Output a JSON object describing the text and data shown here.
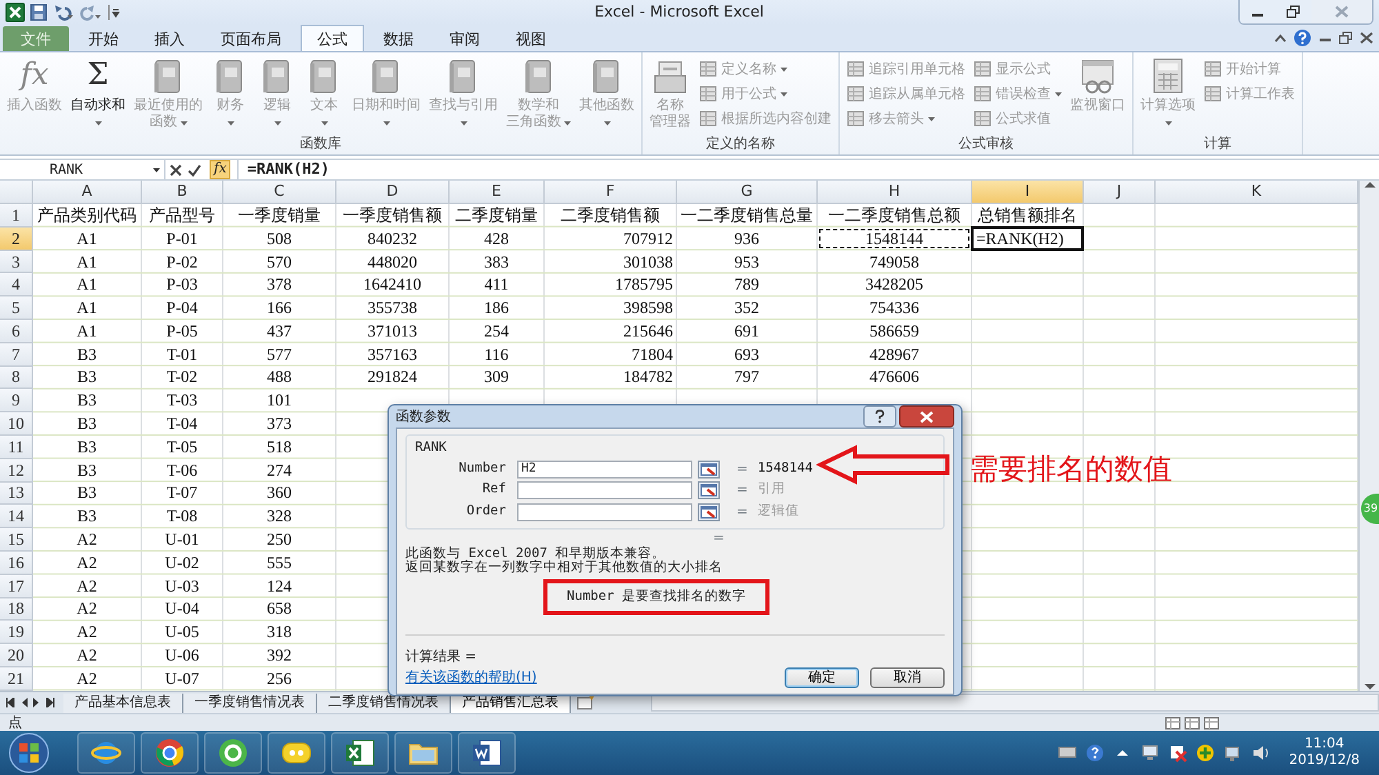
{
  "title_bar": {
    "title": "Excel - Microsoft Excel"
  },
  "ribbon_tabs": [
    {
      "label": "文件",
      "kind": "file",
      "selected": false
    },
    {
      "label": "开始",
      "kind": "tab",
      "selected": false
    },
    {
      "label": "插入",
      "kind": "tab",
      "selected": false
    },
    {
      "label": "页面布局",
      "kind": "tab",
      "selected": false
    },
    {
      "label": "公式",
      "kind": "tab",
      "selected": true
    },
    {
      "label": "数据",
      "kind": "tab",
      "selected": false
    },
    {
      "label": "审阅",
      "kind": "tab",
      "selected": false
    },
    {
      "label": "视图",
      "kind": "tab",
      "selected": false
    }
  ],
  "ribbon_groups": [
    {
      "label": "函数库",
      "buttons": [
        {
          "kind": "large",
          "glyph": "fx",
          "label": [
            "插入函数"
          ],
          "disabled": true,
          "dropdown": false
        },
        {
          "kind": "large",
          "glyph": "Σ",
          "label": [
            "自动求和"
          ],
          "disabled": false,
          "dropdown": true
        },
        {
          "kind": "large",
          "label": [
            "最近使用的",
            "函数"
          ],
          "disabled": true,
          "dropdown": true
        },
        {
          "kind": "large",
          "label": [
            "财务"
          ],
          "disabled": true,
          "dropdown": true
        },
        {
          "kind": "large",
          "label": [
            "逻辑"
          ],
          "disabled": true,
          "dropdown": true
        },
        {
          "kind": "large",
          "label": [
            "文本"
          ],
          "disabled": true,
          "dropdown": true
        },
        {
          "kind": "large",
          "label": [
            "日期和时间"
          ],
          "disabled": true,
          "dropdown": true
        },
        {
          "kind": "large",
          "label": [
            "查找与引用"
          ],
          "disabled": true,
          "dropdown": true
        },
        {
          "kind": "large",
          "label": [
            "数学和",
            "三角函数"
          ],
          "disabled": true,
          "dropdown": true
        },
        {
          "kind": "large",
          "label": [
            "其他函数"
          ],
          "disabled": true,
          "dropdown": true
        }
      ]
    },
    {
      "label": "定义的名称",
      "buttons": [
        {
          "kind": "large",
          "label": [
            "名称",
            "管理器"
          ],
          "disabled": true,
          "dropdown": false
        },
        {
          "kind": "small",
          "label": "定义名称",
          "disabled": true,
          "dropdown": true
        },
        {
          "kind": "small",
          "label": "用于公式",
          "disabled": true,
          "dropdown": true
        },
        {
          "kind": "small",
          "label": "根据所选内容创建",
          "disabled": true,
          "dropdown": false
        }
      ]
    },
    {
      "label": "公式审核",
      "buttons": [
        {
          "kind": "small",
          "label": "追踪引用单元格",
          "disabled": true,
          "dropdown": false
        },
        {
          "kind": "small",
          "label": "追踪从属单元格",
          "disabled": true,
          "dropdown": false
        },
        {
          "kind": "small",
          "label": "移去箭头",
          "disabled": true,
          "dropdown": true
        },
        {
          "kind": "small",
          "label": "显示公式",
          "disabled": true,
          "dropdown": false
        },
        {
          "kind": "small",
          "label": "错误检查",
          "disabled": true,
          "dropdown": true
        },
        {
          "kind": "small",
          "label": "公式求值",
          "disabled": true,
          "dropdown": false
        },
        {
          "kind": "large",
          "label": [
            "监视窗口"
          ],
          "disabled": true,
          "dropdown": false
        }
      ]
    },
    {
      "label": "计算",
      "buttons": [
        {
          "kind": "large",
          "label": [
            "计算选项"
          ],
          "disabled": true,
          "dropdown": true
        },
        {
          "kind": "small",
          "label": "开始计算",
          "disabled": true,
          "dropdown": false
        },
        {
          "kind": "small",
          "label": "计算工作表",
          "disabled": true,
          "dropdown": false
        }
      ]
    }
  ],
  "formula_bar": {
    "name_box": "RANK",
    "fx": "fx",
    "formula": "=RANK(H2)"
  },
  "columns": [
    {
      "label": "A",
      "selected": false
    },
    {
      "label": "B",
      "selected": false
    },
    {
      "label": "C",
      "selected": false
    },
    {
      "label": "D",
      "selected": false
    },
    {
      "label": "E",
      "selected": false
    },
    {
      "label": "F",
      "selected": false
    },
    {
      "label": "G",
      "selected": false
    },
    {
      "label": "H",
      "selected": false
    },
    {
      "label": "I",
      "selected": true
    },
    {
      "label": "J",
      "selected": false
    },
    {
      "label": "K",
      "selected": false
    }
  ],
  "rows": [
    {
      "header": "1",
      "selected": false,
      "cells": [
        "产品类别代码",
        "产品型号",
        "一季度销量",
        "一季度销售额",
        "二季度销量",
        "二季度销售额",
        "一二季度销售总量",
        "一二季度销售总额",
        "总销售额排名"
      ]
    },
    {
      "header": "2",
      "selected": true,
      "cells": [
        "A1",
        "P-01",
        "508",
        "840232",
        "428",
        "707912",
        "936",
        {
          "text": "1548144",
          "marquee": true
        },
        {
          "text": "=RANK(H2)",
          "editing": true
        }
      ]
    },
    {
      "header": "3",
      "selected": false,
      "cells": [
        "A1",
        "P-02",
        "570",
        "448020",
        "383",
        "301038",
        "953",
        "749058"
      ]
    },
    {
      "header": "4",
      "selected": false,
      "cells": [
        "A1",
        "P-03",
        "378",
        "1642410",
        "411",
        "1785795",
        "789",
        "3428205"
      ]
    },
    {
      "header": "5",
      "selected": false,
      "cells": [
        "A1",
        "P-04",
        "166",
        "355738",
        "186",
        "398598",
        "352",
        "754336"
      ]
    },
    {
      "header": "6",
      "selected": false,
      "cells": [
        "A1",
        "P-05",
        "437",
        "371013",
        "254",
        "215646",
        "691",
        "586659"
      ]
    },
    {
      "header": "7",
      "selected": false,
      "cells": [
        "B3",
        "T-01",
        "577",
        "357163",
        "116",
        "71804",
        "693",
        "428967"
      ]
    },
    {
      "header": "8",
      "selected": false,
      "cells": [
        "B3",
        "T-02",
        "488",
        "291824",
        "309",
        "184782",
        "797",
        "476606"
      ]
    },
    {
      "header": "9",
      "selected": false,
      "cells": [
        "B3",
        "T-03",
        "101"
      ]
    },
    {
      "header": "10",
      "selected": false,
      "cells": [
        "B3",
        "T-04",
        "373"
      ]
    },
    {
      "header": "11",
      "selected": false,
      "cells": [
        "B3",
        "T-05",
        "518"
      ]
    },
    {
      "header": "12",
      "selected": false,
      "cells": [
        "B3",
        "T-06",
        "274"
      ]
    },
    {
      "header": "13",
      "selected": false,
      "cells": [
        "B3",
        "T-07",
        "360"
      ]
    },
    {
      "header": "14",
      "selected": false,
      "cells": [
        "B3",
        "T-08",
        "328"
      ]
    },
    {
      "header": "15",
      "selected": false,
      "cells": [
        "A2",
        "U-01",
        "250"
      ]
    },
    {
      "header": "16",
      "selected": false,
      "cells": [
        "A2",
        "U-02",
        "555"
      ]
    },
    {
      "header": "17",
      "selected": false,
      "cells": [
        "A2",
        "U-03",
        "124"
      ]
    },
    {
      "header": "18",
      "selected": false,
      "cells": [
        "A2",
        "U-04",
        "658"
      ]
    },
    {
      "header": "19",
      "selected": false,
      "cells": [
        "A2",
        "U-05",
        "318"
      ]
    },
    {
      "header": "20",
      "selected": false,
      "cells": [
        "A2",
        "U-06",
        "392"
      ]
    },
    {
      "header": "21",
      "selected": false,
      "cells": [
        "A2",
        "U-07",
        "256"
      ]
    }
  ],
  "dialog": {
    "title": "函数参数",
    "function": "RANK",
    "args": [
      {
        "label": "Number",
        "value": "H2",
        "sign": "=",
        "result": "1548144",
        "muted": false
      },
      {
        "label": "Ref",
        "sign": "=",
        "result": "引用",
        "muted": true
      },
      {
        "label": "Order",
        "sign": "=",
        "result": "逻辑值",
        "muted": true
      }
    ],
    "equals": "=",
    "description": [
      "此函数与 Excel 2007 和早期版本兼容。",
      "返回某数字在一列数字中相对于其他数值的大小排名"
    ],
    "arg_help": {
      "text": "Number 是要查找排名的数字",
      "highlighted": true
    },
    "result_label": "计算结果 =",
    "help_link": "有关该函数的帮助(H)",
    "buttons": [
      {
        "label": "确定",
        "default": true
      },
      {
        "label": "取消",
        "default": false
      }
    ]
  },
  "annotation": {
    "text": "需要排名的数值"
  },
  "side_badge": {
    "text": "39"
  },
  "sheet_tabs": [
    {
      "label": "产品基本信息表",
      "selected": false
    },
    {
      "label": "一季度销售情况表",
      "selected": false
    },
    {
      "label": "二季度销售情况表",
      "selected": false
    },
    {
      "label": "产品销售汇总表",
      "selected": true
    }
  ],
  "status_bar": {
    "mode": "点"
  },
  "taskbar": {
    "apps": [
      {
        "kind": "globe"
      },
      {
        "kind": "wheel"
      },
      {
        "kind": "green"
      },
      {
        "kind": "chat"
      },
      {
        "kind": "sheet"
      },
      {
        "kind": "folder"
      },
      {
        "kind": "doc"
      }
    ],
    "time": "11:04",
    "date": "2019/12/8"
  }
}
